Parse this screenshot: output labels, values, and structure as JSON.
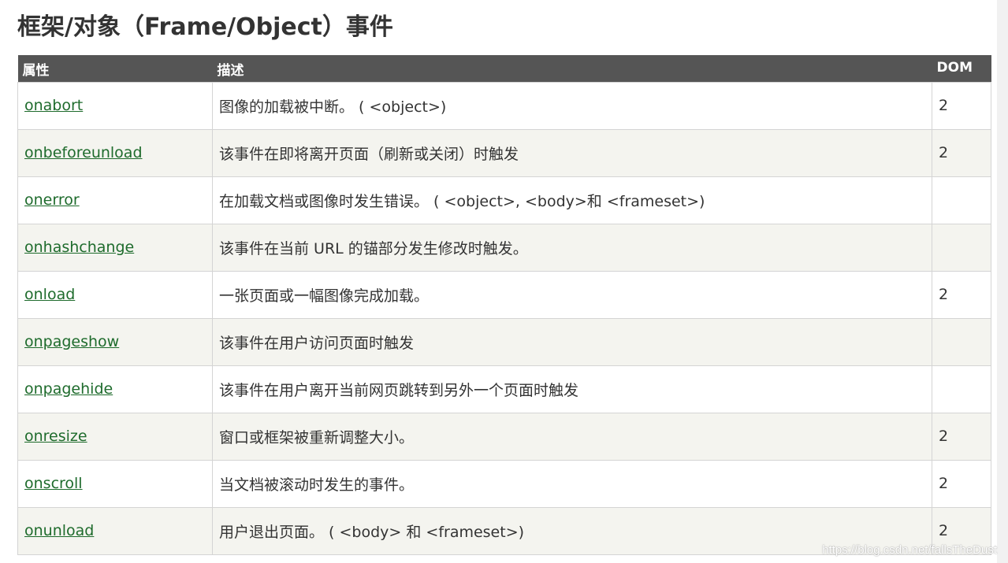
{
  "title": "框架/对象（Frame/Object）事件",
  "table": {
    "headers": {
      "attr": "属性",
      "desc": "描述",
      "dom": "DOM"
    },
    "rows": [
      {
        "attr": "onabort",
        "desc": "图像的加载被中断。 ( <object>)",
        "dom": "2"
      },
      {
        "attr": "onbeforeunload",
        "desc": "该事件在即将离开页面（刷新或关闭）时触发",
        "dom": "2"
      },
      {
        "attr": "onerror",
        "desc": "在加载文档或图像时发生错误。 ( <object>, <body>和 <frameset>)",
        "dom": ""
      },
      {
        "attr": "onhashchange",
        "desc": "该事件在当前 URL 的锚部分发生修改时触发。",
        "dom": ""
      },
      {
        "attr": "onload",
        "desc": "一张页面或一幅图像完成加载。",
        "dom": "2"
      },
      {
        "attr": "onpageshow",
        "desc": "该事件在用户访问页面时触发",
        "dom": ""
      },
      {
        "attr": "onpagehide",
        "desc": "该事件在用户离开当前网页跳转到另外一个页面时触发",
        "dom": ""
      },
      {
        "attr": "onresize",
        "desc": "窗口或框架被重新调整大小。",
        "dom": "2"
      },
      {
        "attr": "onscroll",
        "desc": "当文档被滚动时发生的事件。",
        "dom": "2"
      },
      {
        "attr": "onunload",
        "desc": "用户退出页面。 ( <body> 和 <frameset>)",
        "dom": "2"
      }
    ]
  },
  "watermark": "https://blog.csdn.net/fallsTheDust",
  "colors": {
    "header_bg": "#555555",
    "link": "#1e6b2c",
    "alt_row": "#f4f4ef"
  }
}
